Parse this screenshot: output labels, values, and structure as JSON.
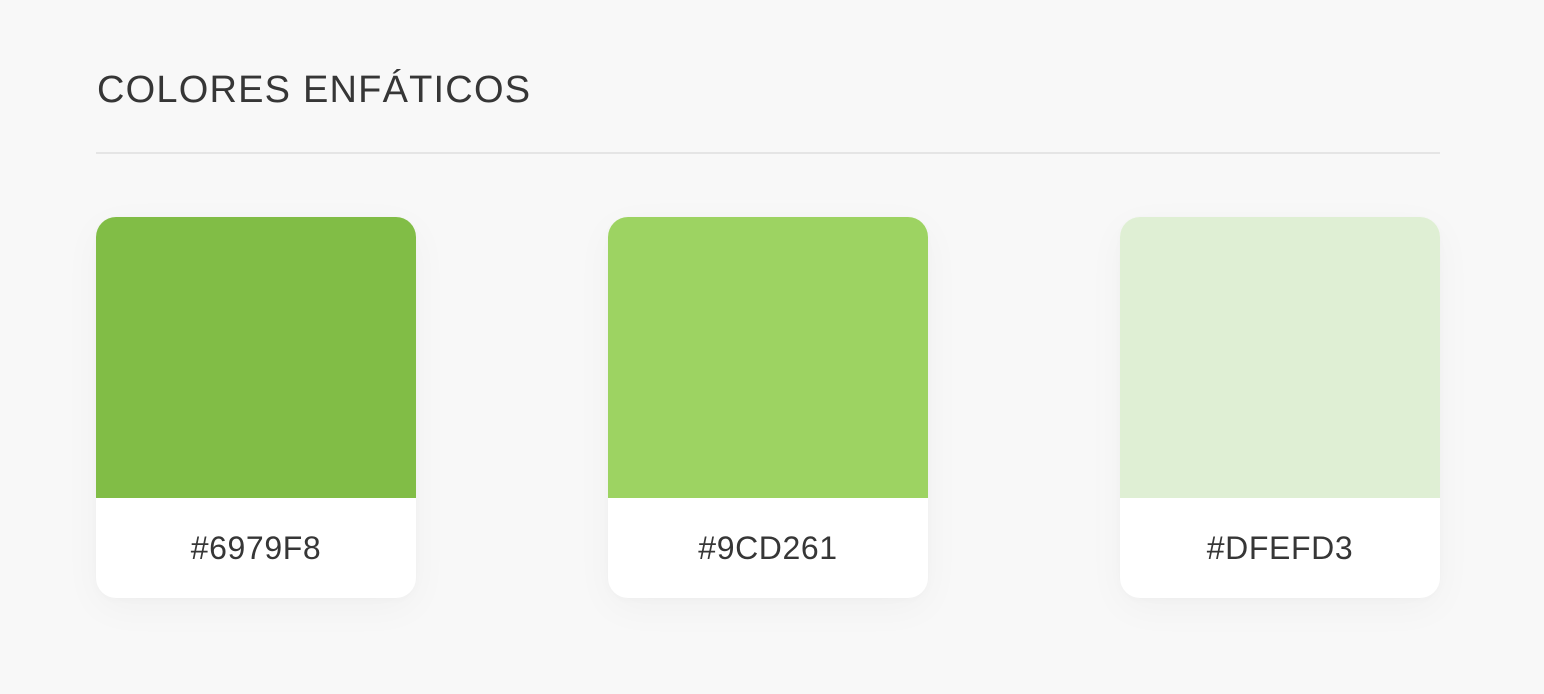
{
  "section": {
    "title": "COLORES ENFÁTICOS"
  },
  "swatches": [
    {
      "label": "#6979F8",
      "color": "#81bd46"
    },
    {
      "label": "#9CD261",
      "color": "#9dd362"
    },
    {
      "label": "#DFEFD3",
      "color": "#dfefd4"
    }
  ]
}
